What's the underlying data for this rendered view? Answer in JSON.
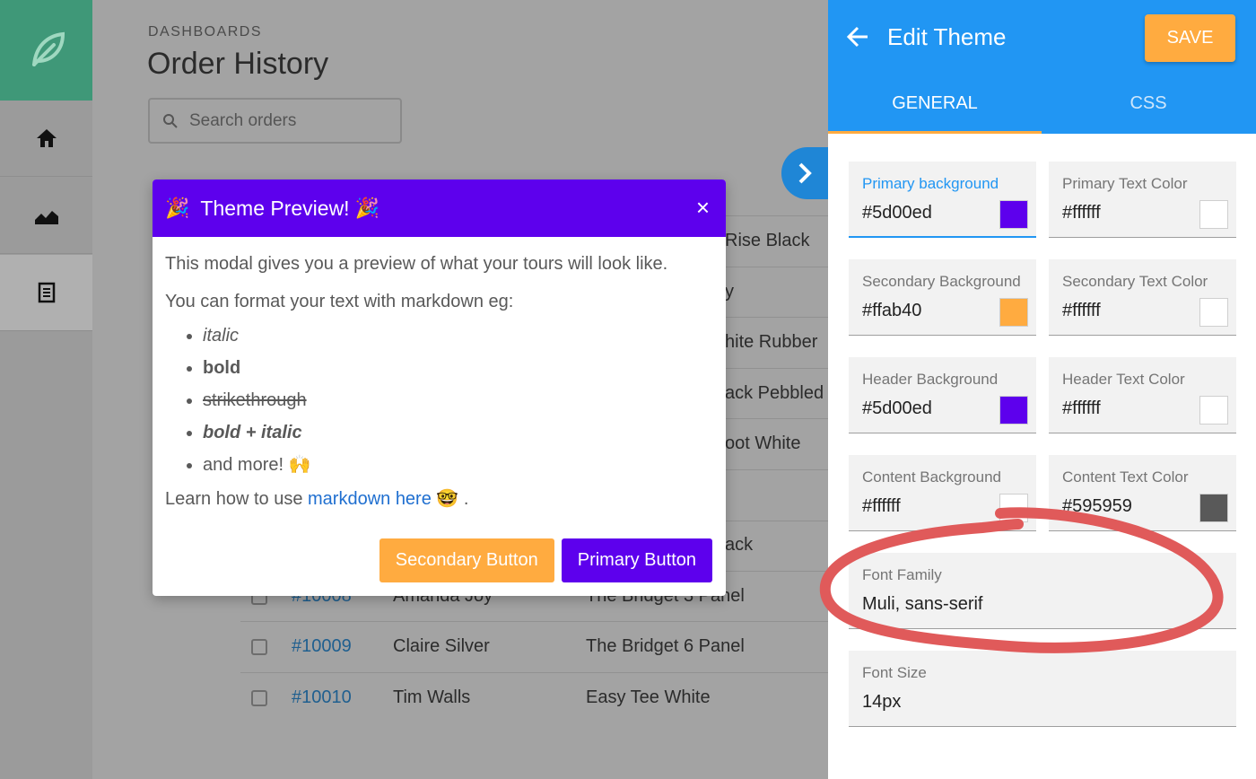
{
  "main": {
    "breadcrumb": "DASHBOARDS",
    "title": "Order History",
    "search_placeholder": "Search orders",
    "partial_rows": [
      "Rise Black",
      "y",
      "hite Rubber",
      "ack Pebbled",
      "oot White",
      "ack"
    ],
    "rows": [
      {
        "id": "#10008",
        "name": "Amanda Joy",
        "product": "The Bridget 3 Panel"
      },
      {
        "id": "#10009",
        "name": "Claire Silver",
        "product": "The Bridget 6 Panel"
      },
      {
        "id": "#10010",
        "name": "Tim Walls",
        "product": "Easy Tee White"
      }
    ]
  },
  "modal": {
    "party_emoji": "🎉",
    "title": "Theme Preview!",
    "close": "×",
    "intro": "This modal gives you a preview of what your tours will look like.",
    "format_line": "You can format your text with markdown eg:",
    "list": {
      "italic": "italic",
      "bold": "bold",
      "strike": "strikethrough",
      "bold_italic": "bold + italic",
      "more": "and more! 🙌"
    },
    "learn_prefix": "Learn how to use ",
    "learn_link": "markdown here",
    "learn_suffix": " 🤓 .",
    "secondary_button": "Secondary Button",
    "primary_button": "Primary Button"
  },
  "panel": {
    "title": "Edit Theme",
    "save": "SAVE",
    "tabs": {
      "general": "GENERAL",
      "css": "CSS"
    },
    "fields": [
      {
        "label": "Primary background",
        "value": "#5d00ed",
        "swatch": "#5d00ed"
      },
      {
        "label": "Primary Text Color",
        "value": "#ffffff",
        "swatch": "#ffffff"
      },
      {
        "label": "Secondary Background",
        "value": "#ffab40",
        "swatch": "#ffab40"
      },
      {
        "label": "Secondary Text Color",
        "value": "#ffffff",
        "swatch": "#ffffff"
      },
      {
        "label": "Header Background",
        "value": "#5d00ed",
        "swatch": "#5d00ed"
      },
      {
        "label": "Header Text Color",
        "value": "#ffffff",
        "swatch": "#ffffff"
      },
      {
        "label": "Content Background",
        "value": "#ffffff",
        "swatch": "#ffffff"
      },
      {
        "label": "Content Text Color",
        "value": "#595959",
        "swatch": "#595959"
      }
    ],
    "font_family": {
      "label": "Font Family",
      "value": "Muli, sans-serif"
    },
    "font_size": {
      "label": "Font Size",
      "value": "14px"
    }
  },
  "colors": {
    "brand_green": "#3f9878",
    "panel_blue": "#2196f3",
    "primary": "#5d00ed",
    "secondary": "#ffab40",
    "annotation_red": "#e05a5a"
  }
}
